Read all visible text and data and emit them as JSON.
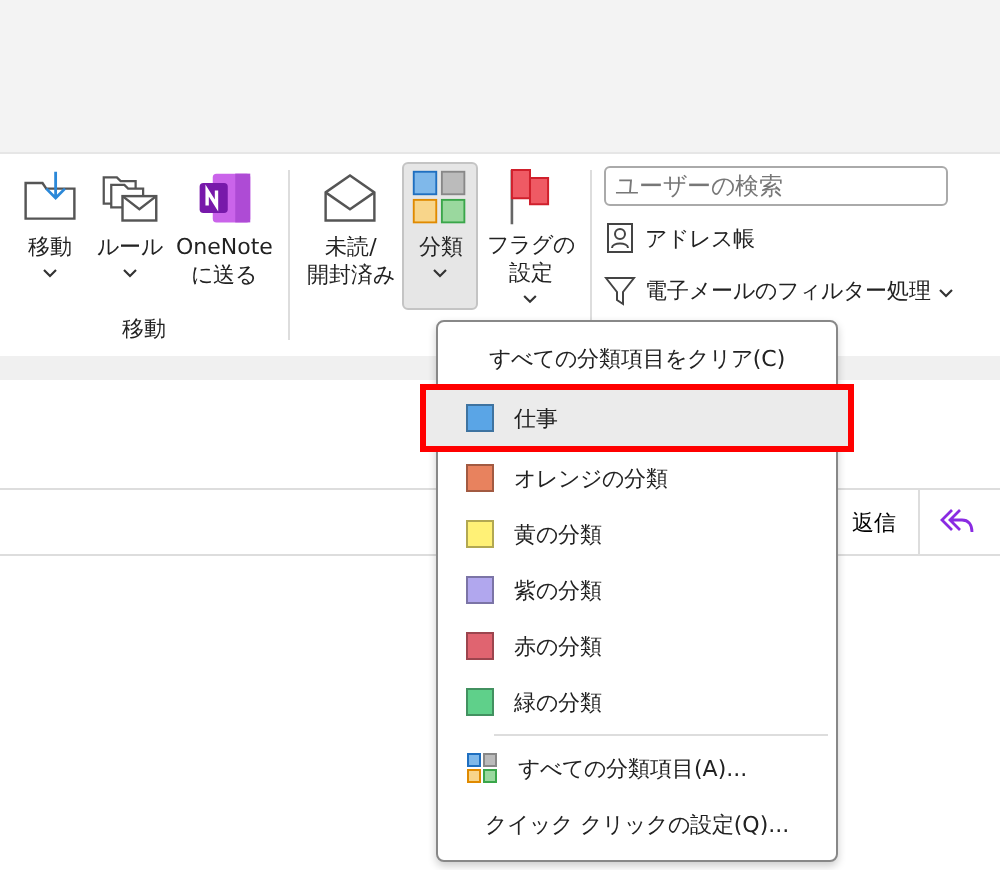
{
  "ribbon": {
    "groups": [
      {
        "label": "移動",
        "buttons": [
          {
            "lines": [
              "移動"
            ],
            "kind": "move",
            "dropdown": true,
            "pressed": false
          },
          {
            "lines": [
              "ルール"
            ],
            "kind": "rules",
            "dropdown": true,
            "pressed": false
          },
          {
            "lines": [
              "OneNote",
              "に送る"
            ],
            "kind": "onenote",
            "dropdown": false,
            "pressed": false
          }
        ]
      },
      {
        "buttons": [
          {
            "lines": [
              "未読/",
              "開封済み"
            ],
            "kind": "envelope",
            "dropdown": false,
            "pressed": false
          },
          {
            "lines": [
              "分類"
            ],
            "kind": "categories",
            "dropdown": true,
            "pressed": true
          },
          {
            "lines": [
              "フラグの",
              "設定"
            ],
            "kind": "flag",
            "dropdown": true,
            "pressed": false
          }
        ]
      }
    ],
    "search": {
      "placeholder": "ユーザーの検索"
    },
    "commands": [
      {
        "label": "アドレス帳",
        "kind": "person",
        "dropdown": false
      },
      {
        "label": "電子メールのフィルター処理",
        "kind": "filter",
        "dropdown": true
      }
    ]
  },
  "message_bar": {
    "reply": "返信"
  },
  "menu": {
    "items": [
      {
        "kind": "text",
        "label": "すべての分類項目をクリア(C)"
      },
      {
        "kind": "category",
        "label": "仕事",
        "color": "#5aa5e6",
        "selected": true
      },
      {
        "kind": "category",
        "label": "オレンジの分類",
        "color": "#e8825e",
        "selected": false
      },
      {
        "kind": "category",
        "label": "黄の分類",
        "color": "#fff176",
        "selected": false
      },
      {
        "kind": "category",
        "label": "紫の分類",
        "color": "#b1a7ee",
        "selected": false
      },
      {
        "kind": "category",
        "label": "赤の分類",
        "color": "#e06470",
        "selected": false
      },
      {
        "kind": "category",
        "label": "緑の分類",
        "color": "#5fd08a",
        "selected": false
      },
      {
        "kind": "separator"
      },
      {
        "kind": "grid",
        "label": "すべての分類項目(A)..."
      },
      {
        "kind": "text",
        "label": "クイック クリックの設定(Q)..."
      }
    ]
  }
}
